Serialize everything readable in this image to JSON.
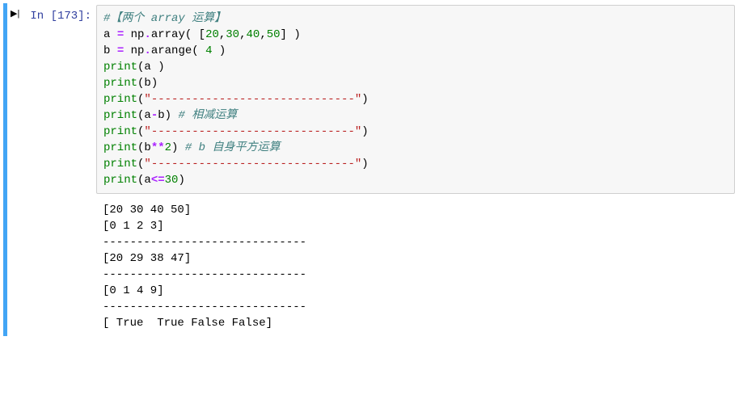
{
  "prompt": {
    "label": "In  [173]:"
  },
  "run_icon": "▶|",
  "code": {
    "line1_comment": "#【两个 array 运算】",
    "line2_a": "a ",
    "line2_eq": "=",
    "line2_np": " np",
    "line2_dot": ".",
    "line2_array": "array( [",
    "line2_n1": "20",
    "line2_c1": ",",
    "line2_n2": "30",
    "line2_c2": ",",
    "line2_n3": "40",
    "line2_c3": ",",
    "line2_n4": "50",
    "line2_close": "] )",
    "line3_b": "b ",
    "line3_eq": "=",
    "line3_np": " np",
    "line3_dot": ".",
    "line3_arange": "arange( ",
    "line3_n": "4",
    "line3_close": " )",
    "line4_print": "print",
    "line4_open": "(a )",
    "line5_print": "print",
    "line5_open": "(b)",
    "line6_print": "print",
    "line6_open": "(",
    "line6_str": "\"------------------------------\"",
    "line6_close": ")",
    "line7_print": "print",
    "line7_open": "(a",
    "line7_op": "-",
    "line7_b": "b) ",
    "line7_comment": "# 相减运算",
    "line8_print": "print",
    "line8_open": "(",
    "line8_str": "\"------------------------------\"",
    "line8_close": ")",
    "line9_print": "print",
    "line9_open": "(b",
    "line9_op": "**",
    "line9_n": "2",
    "line9_close": ") ",
    "line9_comment": "# b 自身平方运算",
    "line10_print": "print",
    "line10_open": "(",
    "line10_str": "\"------------------------------\"",
    "line10_close": ")",
    "line11_print": "print",
    "line11_open": "(a",
    "line11_op": "<=",
    "line11_n": "30",
    "line11_close": ")"
  },
  "output": {
    "line1": "[20 30 40 50]",
    "line2": "[0 1 2 3]",
    "line3": "------------------------------",
    "line4": "[20 29 38 47]",
    "line5": "------------------------------",
    "line6": "[0 1 4 9]",
    "line7": "------------------------------",
    "line8": "[ True  True False False]"
  }
}
